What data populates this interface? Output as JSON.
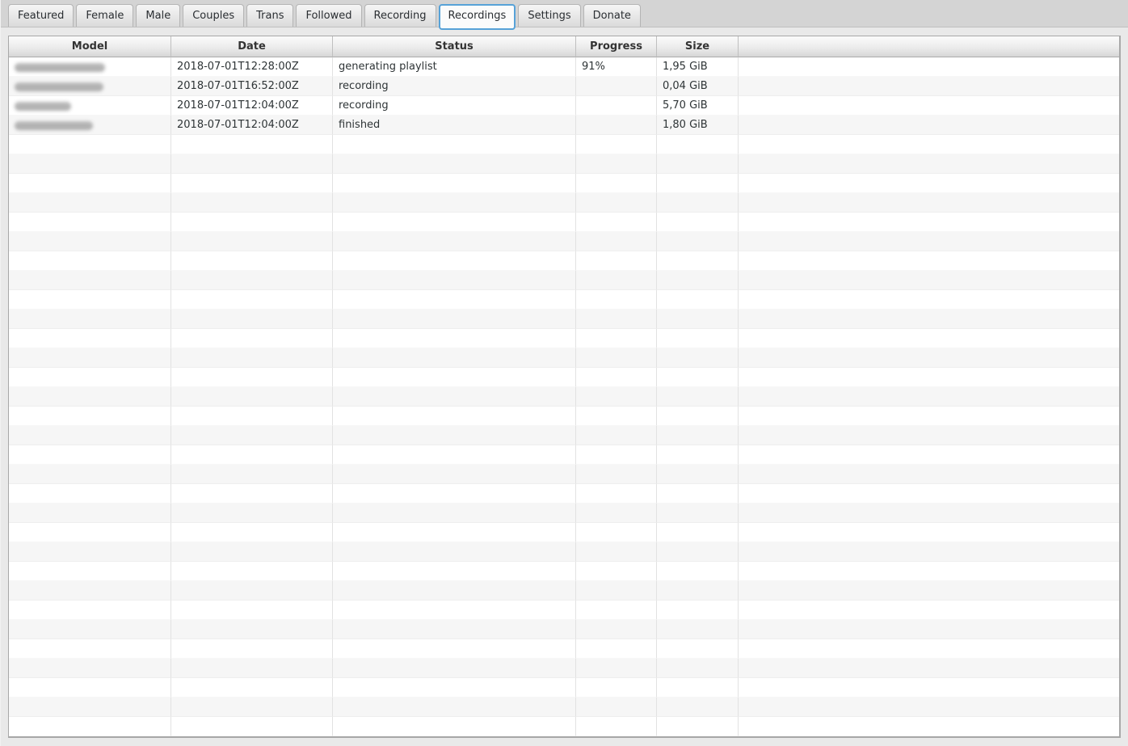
{
  "tabs": [
    {
      "label": "Featured",
      "active": false
    },
    {
      "label": "Female",
      "active": false
    },
    {
      "label": "Male",
      "active": false
    },
    {
      "label": "Couples",
      "active": false
    },
    {
      "label": "Trans",
      "active": false
    },
    {
      "label": "Followed",
      "active": false
    },
    {
      "label": "Recording",
      "active": false
    },
    {
      "label": "Recordings",
      "active": true
    },
    {
      "label": "Settings",
      "active": false
    },
    {
      "label": "Donate",
      "active": false
    }
  ],
  "table": {
    "columns": [
      "Model",
      "Date",
      "Status",
      "Progress",
      "Size",
      ""
    ],
    "rows": [
      {
        "model_redacted": true,
        "model_blob_width": 112,
        "date": "2018-07-01T12:28:00Z",
        "status": "generating playlist",
        "progress": "91%",
        "size": "1,95 GiB"
      },
      {
        "model_redacted": true,
        "model_blob_width": 110,
        "date": "2018-07-01T16:52:00Z",
        "status": "recording",
        "progress": "",
        "size": "0,04 GiB"
      },
      {
        "model_redacted": true,
        "model_blob_width": 70,
        "date": "2018-07-01T12:04:00Z",
        "status": "recording",
        "progress": "",
        "size": "5,70 GiB"
      },
      {
        "model_redacted": true,
        "model_blob_width": 97,
        "date": "2018-07-01T12:04:00Z",
        "status": "finished",
        "progress": "",
        "size": "1,80 GiB"
      }
    ],
    "empty_row_count": 31
  },
  "colors": {
    "accent_blue": "#57a2d8",
    "tab_strip_bg": "#d4d4d4",
    "content_bg": "#e9e9e9",
    "row_stripe": "#f6f6f6",
    "header_text": "#333333",
    "cell_text": "#2e3436"
  }
}
